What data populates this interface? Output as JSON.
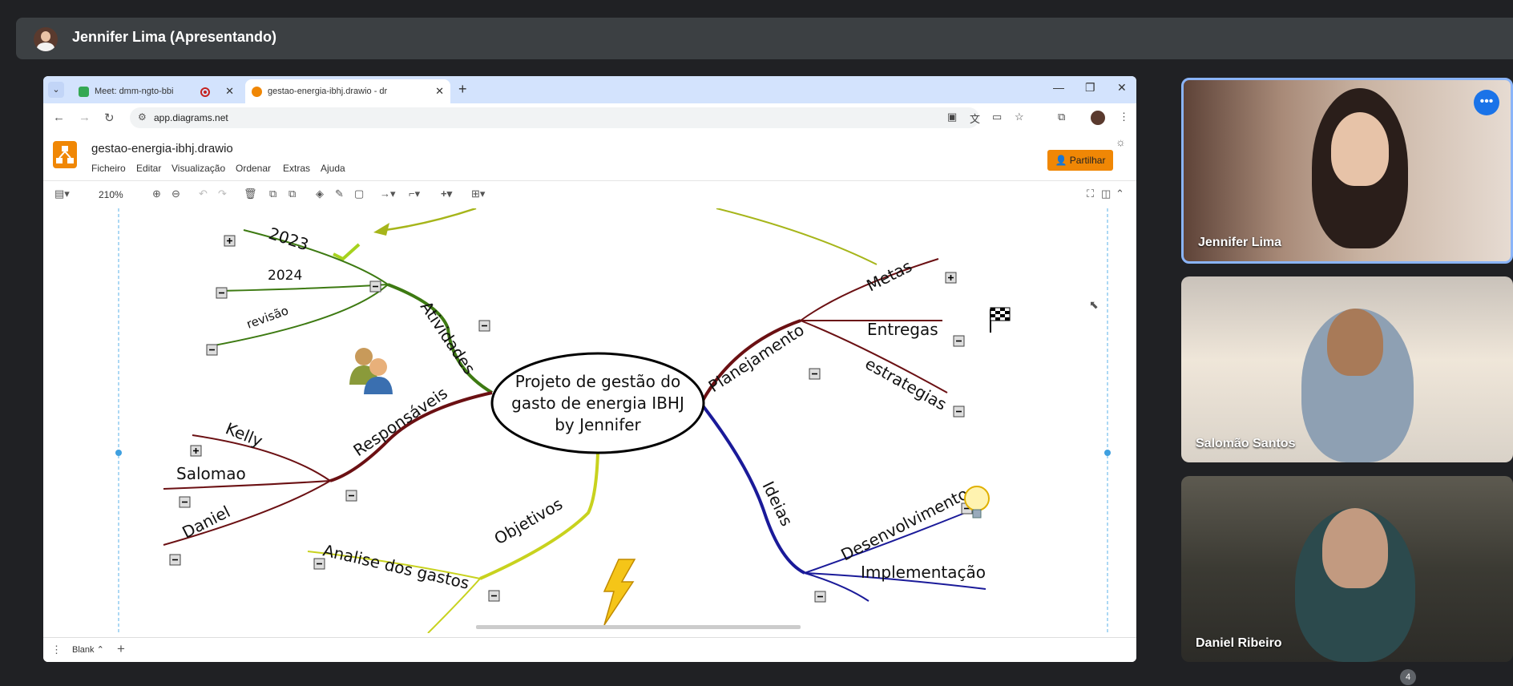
{
  "presenter": {
    "name": "Jennifer Lima (Apresentando)"
  },
  "browser": {
    "tabs": [
      {
        "label": "Meet: dmm-ngto-bbi",
        "active": false
      },
      {
        "label": "gestao-energia-ibhj.drawio - dr",
        "active": true
      }
    ],
    "url": "app.diagrams.net"
  },
  "drawio": {
    "file_title": "gestao-energia-ibhj.drawio",
    "menu": [
      "Ficheiro",
      "Editar",
      "Visualização",
      "Ordenar",
      "Extras",
      "Ajuda"
    ],
    "share_label": "Partilhar",
    "zoom": "210%",
    "page_tab": "Blank"
  },
  "mindmap": {
    "center": [
      "Projeto de gestão do",
      "gasto de energia IBHJ",
      "by Jennifer"
    ],
    "branches": {
      "atividades": "Atividades",
      "responsaveis": "Responsáveis",
      "objetivos": "Objetivos",
      "planejamento": "Planejamento",
      "ideias": "Ideias"
    },
    "leaves": {
      "y2023": "2023",
      "y2024": "2024",
      "revisao": "revisão",
      "kelly": "Kelly",
      "salomao": "Salomao",
      "daniel": "Daniel",
      "analise": "Analise dos gastos",
      "metas": "Metas",
      "entregas": "Entregas",
      "estrategias": "estrategias",
      "desenvolvimento": "Desenvolvimento",
      "implementacao": "Implementação"
    },
    "colors": {
      "atividades": "#3d7a12",
      "responsaveis": "#6b1013",
      "objetivos": "#c8d21e",
      "planejamento": "#6b1013",
      "ideias": "#1a1a99",
      "arrow": "#a6b51a"
    }
  },
  "participants": [
    {
      "name": "Jennifer Lima"
    },
    {
      "name": "Salomão Santos"
    },
    {
      "name": "Daniel Ribeiro"
    }
  ],
  "participant_count": "4"
}
